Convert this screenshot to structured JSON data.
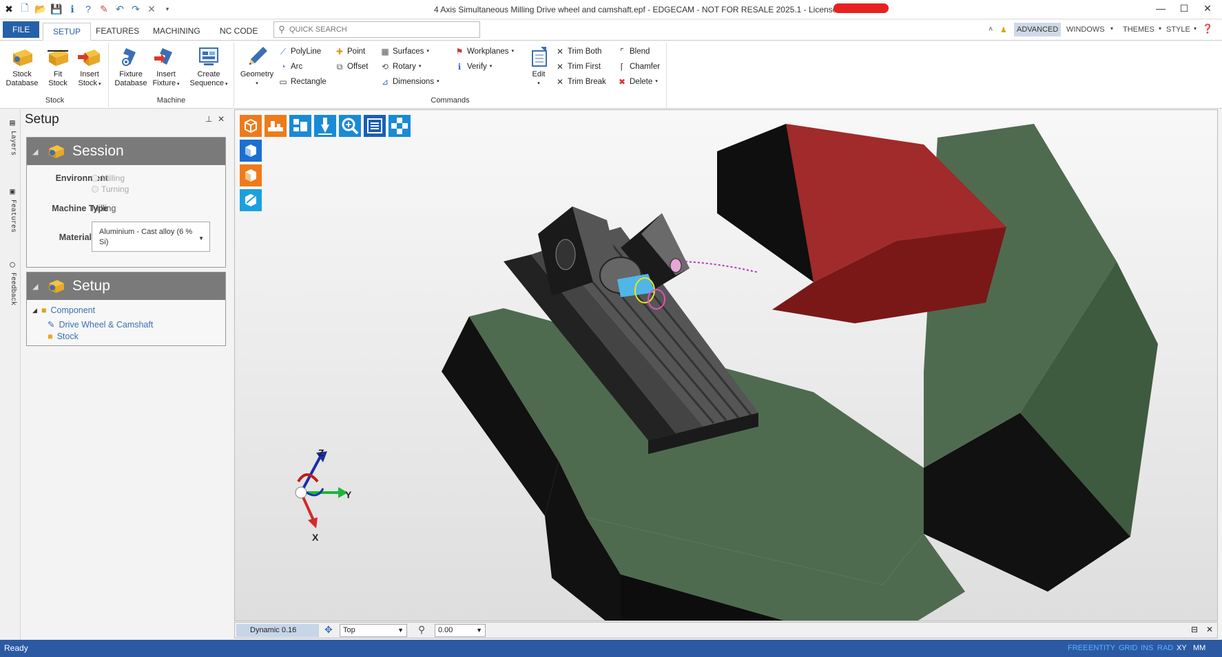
{
  "window": {
    "title": "4 Axis Simultaneous Milling Drive wheel and camshaft.epf - EDGECAM - NOT FOR RESALE 2025.1 - Licensed to"
  },
  "qat": [
    "app-logo",
    "new",
    "open",
    "save",
    "info",
    "help-tool",
    "eraser",
    "undo",
    "redo",
    "cancel",
    "more"
  ],
  "tabs": {
    "file": "FILE",
    "items": [
      "SETUP",
      "FEATURES",
      "MACHINING",
      "NC CODE"
    ],
    "active": "SETUP"
  },
  "search": {
    "placeholder": "QUICK SEARCH"
  },
  "right_menu": {
    "advanced": "ADVANCED",
    "windows": "WINDOWS",
    "themes": "THEMES",
    "style": "STYLE"
  },
  "ribbon": {
    "stock": {
      "label": "Stock",
      "buttons": [
        {
          "l1": "Stock",
          "l2": "Database"
        },
        {
          "l1": "Fit",
          "l2": "Stock"
        },
        {
          "l1": "Insert",
          "l2": "Stock"
        }
      ]
    },
    "machine": {
      "label": "Machine",
      "buttons": [
        {
          "l1": "Fixture",
          "l2": "Database"
        },
        {
          "l1": "Insert",
          "l2": "Fixture"
        },
        {
          "l1": "Create",
          "l2": "Sequence"
        }
      ]
    },
    "commands": {
      "label": "Commands",
      "geometry": "Geometry",
      "edit": "Edit",
      "col1": [
        "PolyLine",
        "Arc",
        "Rectangle"
      ],
      "col2": [
        "Point",
        "Offset"
      ],
      "col3": [
        "Surfaces",
        "Rotary",
        "Dimensions"
      ],
      "col4": [
        "Workplanes",
        "Verify"
      ],
      "col5": [
        "Trim Both",
        "Trim First",
        "Trim Break"
      ],
      "col6": [
        "Blend",
        "Chamfer",
        "Delete"
      ]
    }
  },
  "side_tabs": [
    "Layers",
    "Features",
    "Feedback"
  ],
  "panel": {
    "title": "Setup",
    "session": {
      "title": "Session",
      "environment_label": "Environment",
      "env_options": [
        "Milling",
        "Turning"
      ],
      "machine_type_label": "Machine Type",
      "machine_type": "Milling",
      "material_label": "Material",
      "material": "Aluminium - Cast alloy (6 % Si)"
    },
    "setup": {
      "title": "Setup",
      "component": "Component",
      "children": [
        "Drive Wheel & Camshaft",
        "Stock"
      ]
    }
  },
  "viewport": {
    "axes": {
      "x": "X",
      "y": "Y",
      "z": "Z"
    },
    "colors": {
      "base": "#4f6b4f",
      "block": "#a12a2a",
      "dark": "#111111",
      "table": "#555555"
    }
  },
  "view_bar": {
    "mode": "Dynamic 0.16",
    "view": "Top",
    "value": "0.00"
  },
  "status": {
    "text": "Ready",
    "toggles": [
      {
        "label": "FREE",
        "on": false
      },
      {
        "label": "ENTITY",
        "on": false
      },
      {
        "label": "GRID",
        "on": false
      },
      {
        "label": "INS",
        "on": false
      },
      {
        "label": "RAD",
        "on": false
      },
      {
        "label": "XY",
        "on": true
      },
      {
        "label": "MM",
        "on": true
      }
    ]
  }
}
